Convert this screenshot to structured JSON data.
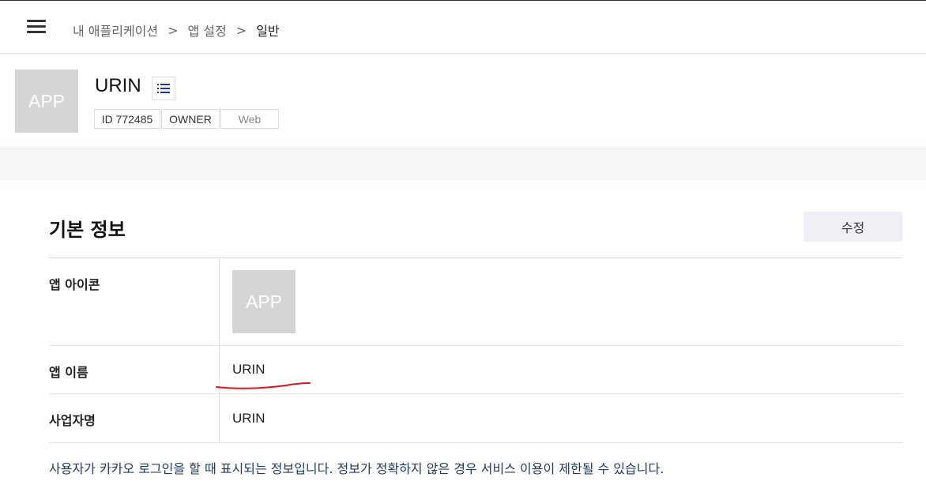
{
  "breadcrumb": {
    "items": [
      "내 애플리케이션",
      "앱 설정",
      "일반"
    ],
    "separator": ">"
  },
  "app": {
    "thumb_label": "APP",
    "name": "URIN",
    "tags": {
      "id": "ID 772485",
      "role": "OWNER",
      "platform": "Web"
    }
  },
  "section": {
    "title": "기본 정보",
    "edit_label": "수정"
  },
  "table": {
    "icon_label": "앱 아이콘",
    "icon_value": "APP",
    "name_label": "앱 이름",
    "name_value": "URIN",
    "business_label": "사업자명",
    "business_value": "URIN"
  },
  "notice": "사용자가 카카오 로그인을 할 때 표시되는 정보입니다. 정보가 정확하지 않은 경우 서비스 이용이 제한될 수 있습니다.",
  "colors": {
    "thumb_bg": "#d5d5d5",
    "edit_button_bg": "#eef0f5",
    "notice_text": "#1f3a63",
    "annotation_red": "#e0141e"
  },
  "icons": {
    "menu": "hamburger-icon",
    "list": "list-icon"
  }
}
